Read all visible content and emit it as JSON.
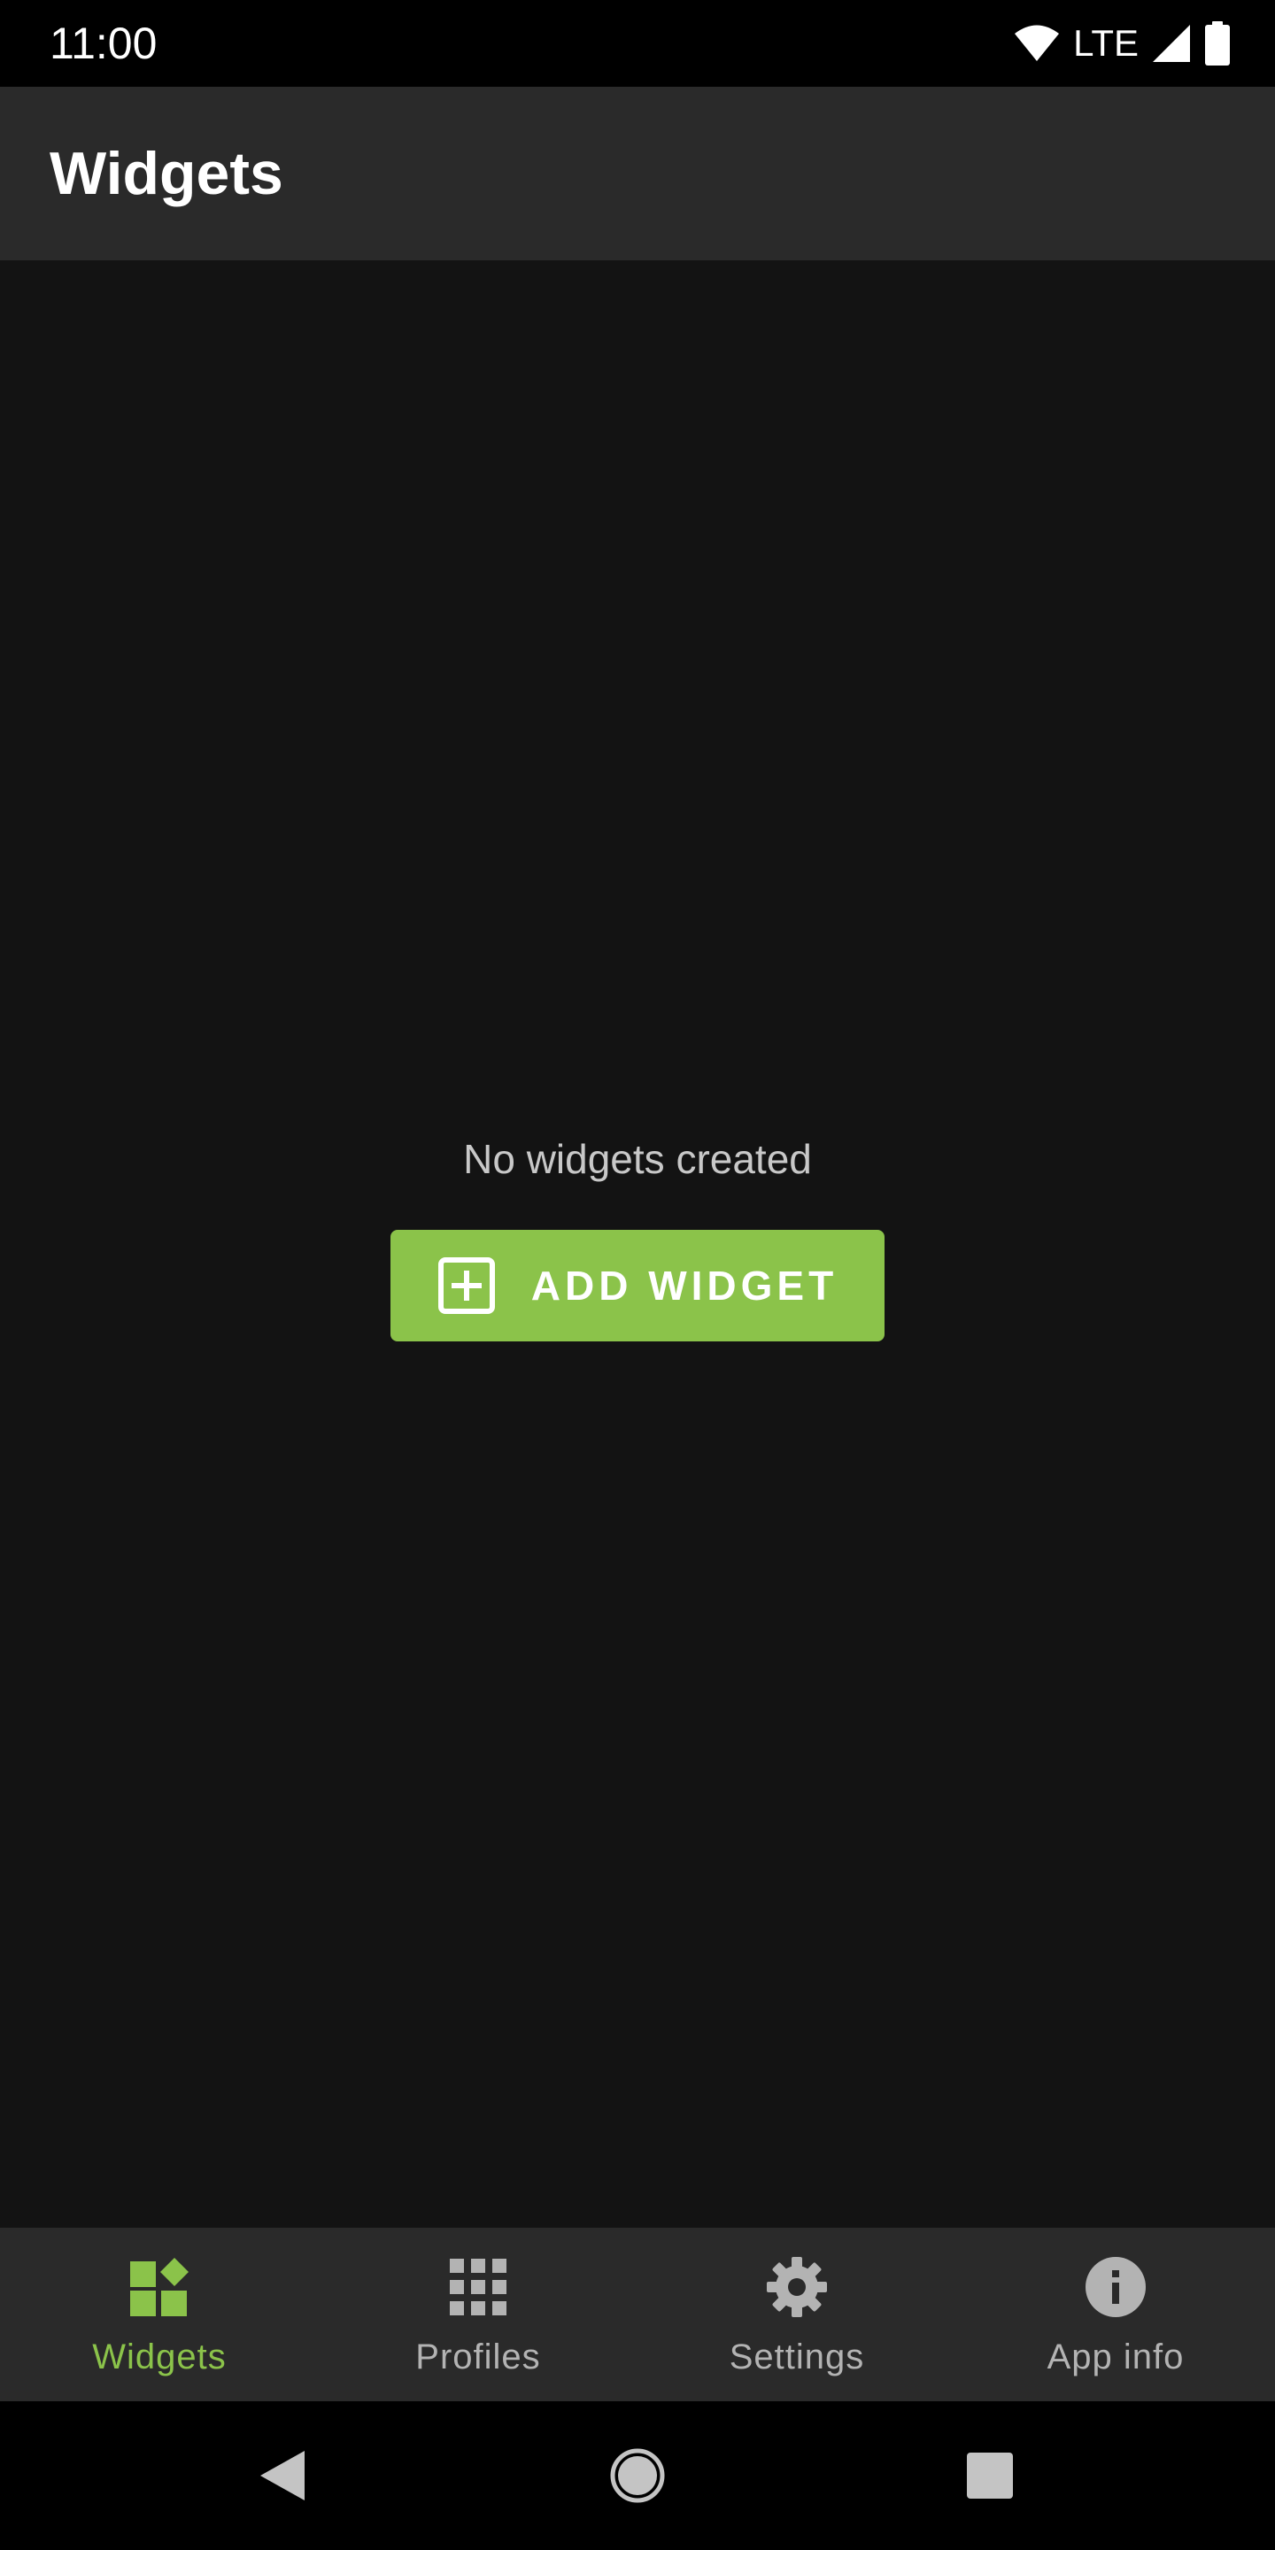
{
  "status_bar": {
    "time": "11:00",
    "network": "LTE",
    "icons": [
      "wifi-icon",
      "signal-icon",
      "battery-icon"
    ]
  },
  "app_bar": {
    "title": "Widgets"
  },
  "empty_state": {
    "message": "No widgets created",
    "button_label": "ADD WIDGET",
    "button_icon": "add-box-icon"
  },
  "bottom_nav": {
    "items": [
      {
        "label": "Widgets",
        "icon": "widgets-icon",
        "active": true
      },
      {
        "label": "Profiles",
        "icon": "apps-grid-icon",
        "active": false
      },
      {
        "label": "Settings",
        "icon": "gear-icon",
        "active": false
      },
      {
        "label": "App info",
        "icon": "info-icon",
        "active": false
      }
    ]
  },
  "system_nav": {
    "buttons": [
      "back-icon",
      "home-icon",
      "recents-icon"
    ]
  },
  "colors": {
    "accent": "#8bc34a",
    "background": "#131313",
    "bars": "#2a2a2a",
    "inactive": "#b3b3b3"
  }
}
